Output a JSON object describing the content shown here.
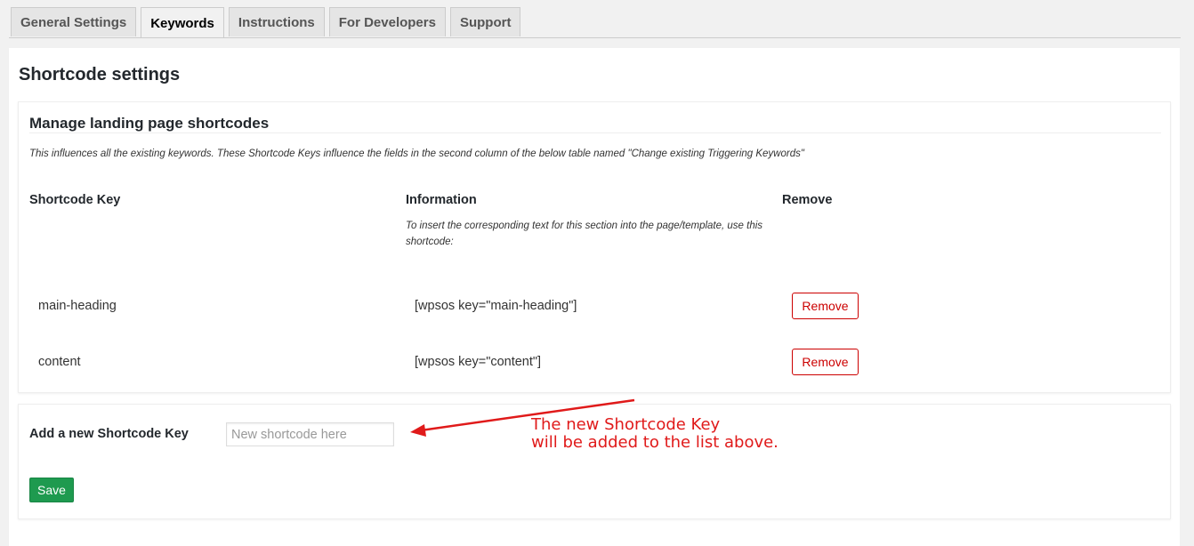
{
  "tabs": [
    {
      "label": "General Settings",
      "active": false
    },
    {
      "label": "Keywords",
      "active": true
    },
    {
      "label": "Instructions",
      "active": false
    },
    {
      "label": "For Developers",
      "active": false
    },
    {
      "label": "Support",
      "active": false
    }
  ],
  "page": {
    "title": "Shortcode settings"
  },
  "manage": {
    "title": "Manage landing page shortcodes",
    "description": "This influences all the existing keywords. These Shortcode Keys influence the fields in the second column of the below table named \"Change existing Triggering Keywords\"",
    "columns": {
      "key": "Shortcode Key",
      "information": "Information",
      "remove": "Remove"
    },
    "info_note": "To insert the corresponding text for this section into the page/template, use this shortcode:",
    "rows": [
      {
        "key": "main-heading",
        "shortcode": "[wpsos key=\"main-heading\"]",
        "remove_label": "Remove"
      },
      {
        "key": "content",
        "shortcode": "[wpsos key=\"content\"]",
        "remove_label": "Remove"
      }
    ]
  },
  "add": {
    "label": "Add a new Shortcode Key",
    "placeholder": "New shortcode here",
    "value": "",
    "save_label": "Save"
  },
  "annotation": {
    "line1": "The new Shortcode Key",
    "line2": "will be added to the list above.",
    "color": "#e01a1a"
  },
  "colors": {
    "accent_save": "#1e9a4f",
    "remove": "#cc0000"
  }
}
